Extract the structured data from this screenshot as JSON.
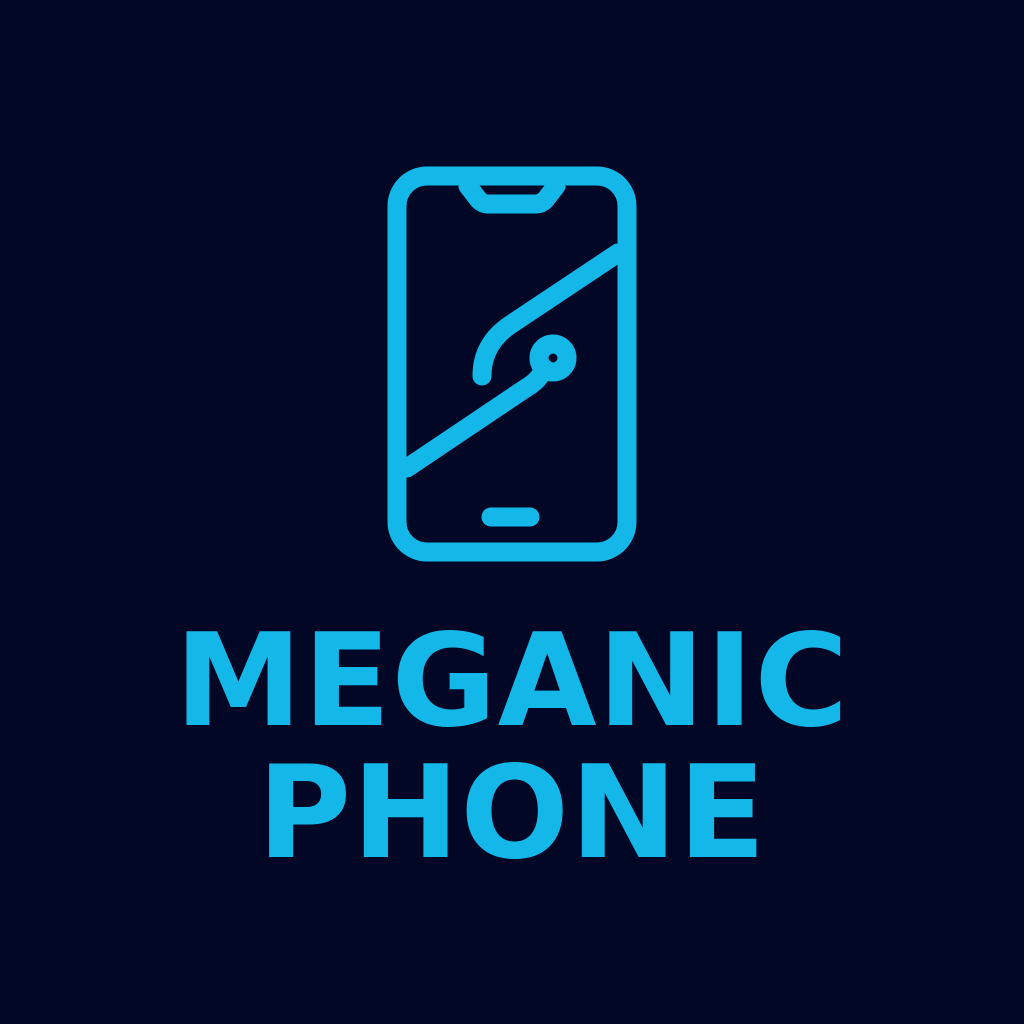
{
  "brand": {
    "line1": "MEGANIC",
    "line2": "PHONE"
  },
  "colors": {
    "background": "#020726",
    "accent": "#13b8e8"
  },
  "icon": "smartphone-circuit-icon"
}
